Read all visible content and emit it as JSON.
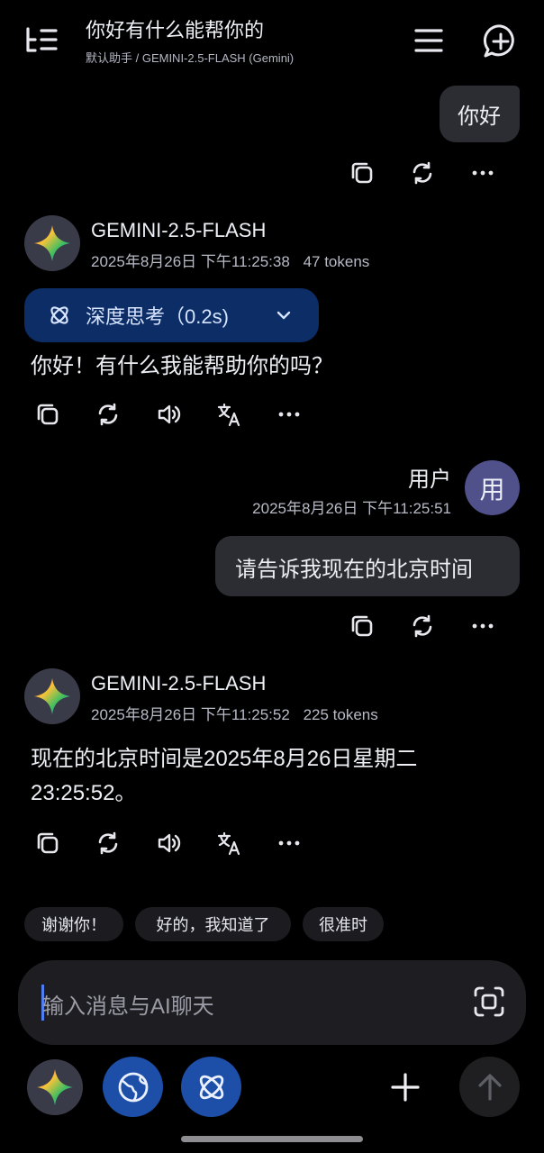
{
  "header": {
    "title": "你好有什么能帮你的",
    "subtitle": "默认助手 / GEMINI-2.5-FLASH (Gemini)",
    "icons": [
      "topics-icon",
      "menu-icon",
      "new-chat-icon"
    ]
  },
  "messages": {
    "user_greeting": {
      "text": "你好"
    },
    "assistant1": {
      "model": "GEMINI-2.5-FLASH",
      "time": "2025年8月26日 下午11:25:38",
      "tokens": "47 tokens",
      "thinking_label": "深度思考（0.2s)",
      "text": "你好！有什么我能帮助你的吗？"
    },
    "user2": {
      "name": "用户",
      "avatar_text": "用",
      "time": "2025年8月26日 下午11:25:51",
      "text": "请告诉我现在的北京时间"
    },
    "assistant2": {
      "model": "GEMINI-2.5-FLASH",
      "time": "2025年8月26日 下午11:25:52",
      "tokens": "225 tokens",
      "text_line1": "现在的北京时间是2025年8月26日星期二",
      "text_line2": "23:25:52。"
    }
  },
  "suggestions": [
    "谢谢你！",
    "好的，我知道了",
    "很准时"
  ],
  "composer": {
    "placeholder": "输入消息与AI聊天"
  },
  "colors": {
    "background": "#000000",
    "bubble": "#2c2d33",
    "thinking_pill": "#0c2d66",
    "accent_blue": "#1d4fa8",
    "user_avatar": "#50518a"
  }
}
